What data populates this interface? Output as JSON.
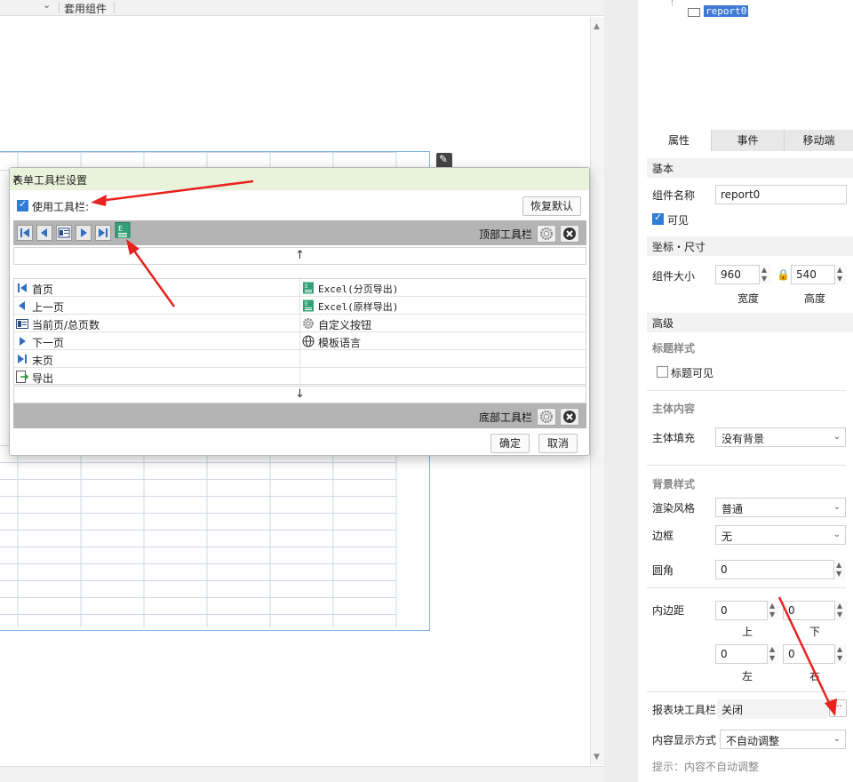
{
  "toolbar_top": {
    "component_set_label": "套用组件"
  },
  "tree": {
    "report_node": "report0"
  },
  "tabs": [
    {
      "label": "属性",
      "active": true
    },
    {
      "label": "事件",
      "active": false
    },
    {
      "label": "移动端",
      "active": false
    }
  ],
  "props": {
    "basic_header": "基本",
    "component_name_label": "组件名称",
    "component_name_value": "report0",
    "visible_label": "可见",
    "visible_checked": true,
    "coords_header": "坐标・尺寸",
    "size_label": "组件大小",
    "width_value": "960",
    "height_value": "540",
    "width_caption": "宽度",
    "height_caption": "高度",
    "advanced_header": "高级",
    "title_style_header": "标题样式",
    "title_visible_label": "标题可见",
    "title_visible_checked": false,
    "body_content_header": "主体内容",
    "body_fill_label": "主体填充",
    "body_fill_value": "没有背景",
    "bg_style_header": "背景样式",
    "render_style_label": "渲染风格",
    "render_style_value": "普通",
    "border_label": "边框",
    "border_value": "无",
    "radius_label": "圆角",
    "radius_value": "0",
    "padding_label": "内边距",
    "pad_top": "0",
    "pad_bottom": "0",
    "pad_left": "0",
    "pad_right": "0",
    "pad_top_caption": "上",
    "pad_bottom_caption": "下",
    "pad_left_caption": "左",
    "pad_right_caption": "右",
    "report_toolbar_label": "报表块工具栏",
    "report_toolbar_value": "关闭",
    "ellipsis": "···",
    "content_display_label": "内容显示方式",
    "content_display_value": "不自动调整",
    "hint": "提示：内容不自动调整"
  },
  "dialog": {
    "title": "表单工具栏设置",
    "use_toolbar_label": "使用工具栏:",
    "use_toolbar_checked": true,
    "restore_default": "恢复默认",
    "top_toolbar_label": "顶部工具栏",
    "bottom_toolbar_label": "底部工具栏",
    "up_arrow": "↑",
    "down_arrow": "↓",
    "left_items": [
      {
        "label": "首页",
        "icon": "first-page-icon"
      },
      {
        "label": "上一页",
        "icon": "prev-page-icon"
      },
      {
        "label": "当前页/总页数",
        "icon": "page-count-icon"
      },
      {
        "label": "下一页",
        "icon": "next-page-icon"
      },
      {
        "label": "末页",
        "icon": "last-page-icon"
      },
      {
        "label": "导出",
        "icon": "export-icon"
      }
    ],
    "right_items": [
      {
        "label": "Excel(分页导出)",
        "icon": "excel-icon"
      },
      {
        "label": "Excel(原样导出)",
        "icon": "excel-icon"
      },
      {
        "label": "自定义按钮",
        "icon": "gear-icon"
      },
      {
        "label": "模板语言",
        "icon": "globe-icon"
      }
    ],
    "ok": "确定",
    "cancel": "取消"
  },
  "colors": {
    "accent": "#2e7dd7",
    "toolbar_gray": "#b4b4b4",
    "dialog_title_bg": "#e9f3dc",
    "annotation_red": "#e8231f"
  }
}
